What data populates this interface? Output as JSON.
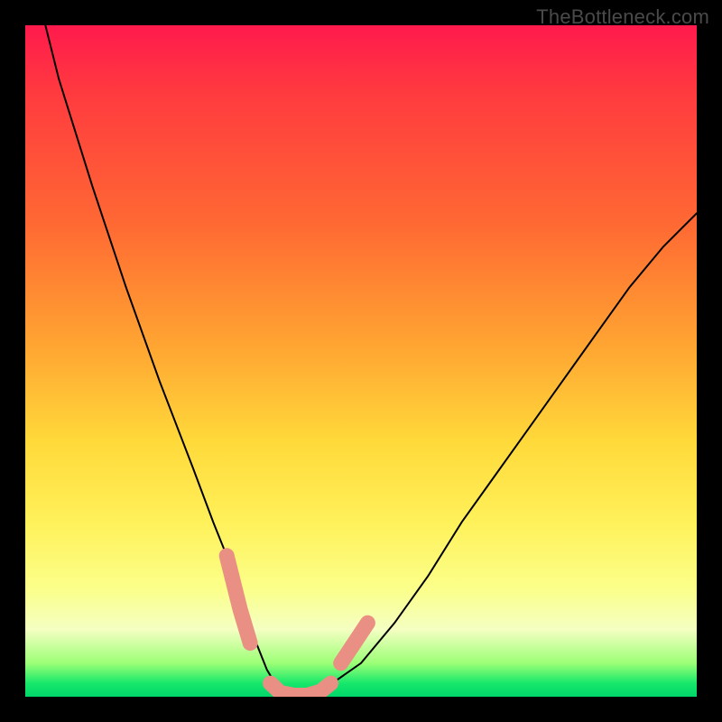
{
  "watermark": "TheBottleneck.com",
  "colors": {
    "frame": "#000000",
    "curve": "#000000",
    "marker": "#e98f84",
    "gradient_stops": [
      "#ff1a4d",
      "#ff6a33",
      "#ffd93a",
      "#fbff8a",
      "#00d66a"
    ]
  },
  "chart_data": {
    "type": "line",
    "title": "",
    "xlabel": "",
    "ylabel": "",
    "xlim": [
      0,
      100
    ],
    "ylim": [
      0,
      100
    ],
    "grid": false,
    "x": [
      3,
      5,
      10,
      15,
      20,
      25,
      28,
      30,
      32,
      34,
      36,
      37.5,
      40,
      42.5,
      45,
      50,
      55,
      60,
      65,
      70,
      75,
      80,
      85,
      90,
      95,
      100
    ],
    "y": [
      100,
      92,
      76,
      61,
      47,
      34,
      26,
      21,
      15,
      9,
      4,
      1.5,
      0.2,
      0.2,
      1.5,
      5,
      11,
      18,
      26,
      33,
      40,
      47,
      54,
      61,
      67,
      72
    ],
    "marker_segments": [
      {
        "x": [
          30,
          32,
          33.5
        ],
        "y": [
          21,
          13,
          8
        ]
      },
      {
        "x": [
          36.5,
          38,
          40,
          42,
          44,
          45.5
        ],
        "y": [
          2,
          0.6,
          0.2,
          0.2,
          0.8,
          2
        ]
      },
      {
        "x": [
          47,
          49,
          51
        ],
        "y": [
          5,
          8,
          11
        ]
      }
    ],
    "annotations": []
  }
}
